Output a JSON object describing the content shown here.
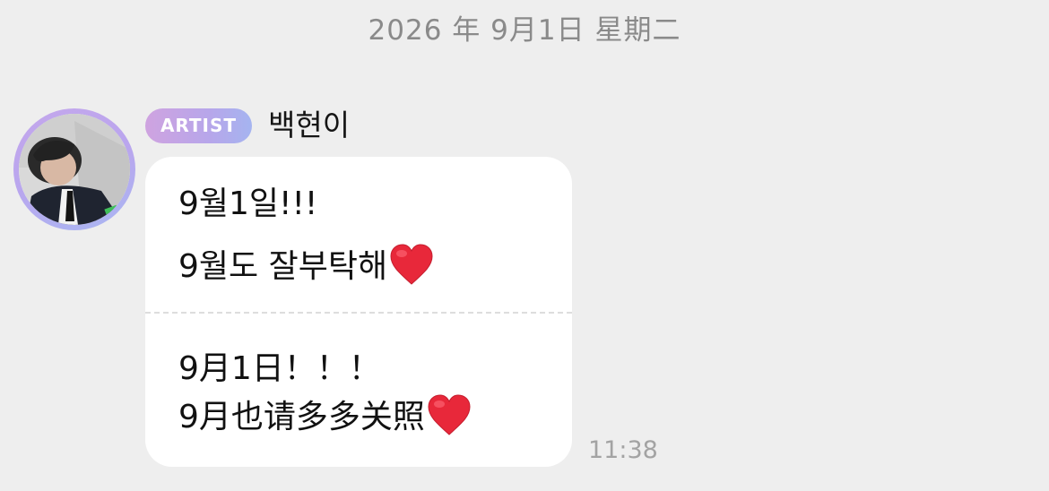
{
  "date_header": "2026 年 9月1日 星期二",
  "sender": {
    "badge": "ARTIST",
    "name": "백현이"
  },
  "message": {
    "original_lines": [
      "9월1일!!!",
      "9월도 잘부탁해"
    ],
    "translated_lines": [
      "9月1日！！！",
      "9月也请多多关照"
    ],
    "time": "11:38"
  },
  "icons": {
    "heart": "red-heart-icon",
    "avatar": "artist-avatar"
  },
  "colors": {
    "background": "#eeeeee",
    "bubble": "#ffffff",
    "heart": "#e8283a",
    "badge_start": "#cfa3e0",
    "badge_end": "#a5b4f0"
  }
}
